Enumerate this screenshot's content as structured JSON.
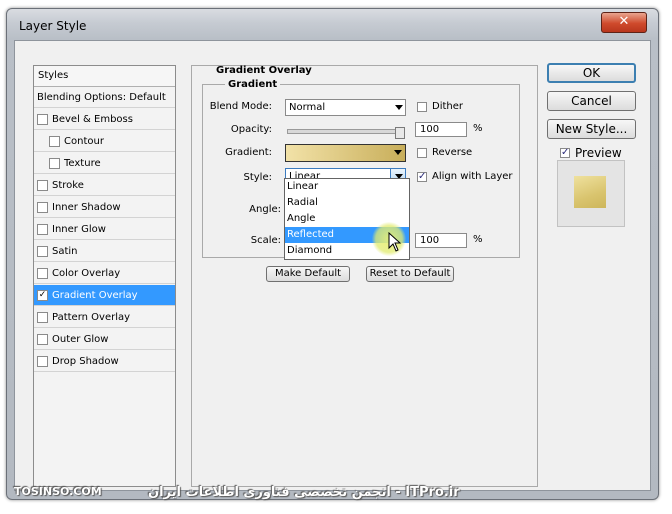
{
  "window": {
    "title": "Layer Style",
    "close_glyph": "✕"
  },
  "styles_panel": {
    "header": "Styles",
    "items": [
      {
        "label": "Blending Options: Default",
        "checkbox": false,
        "checked": false,
        "indent": false,
        "selected": false
      },
      {
        "label": "Bevel & Emboss",
        "checkbox": true,
        "checked": false,
        "indent": false,
        "selected": false
      },
      {
        "label": "Contour",
        "checkbox": true,
        "checked": false,
        "indent": true,
        "selected": false
      },
      {
        "label": "Texture",
        "checkbox": true,
        "checked": false,
        "indent": true,
        "selected": false
      },
      {
        "label": "Stroke",
        "checkbox": true,
        "checked": false,
        "indent": false,
        "selected": false
      },
      {
        "label": "Inner Shadow",
        "checkbox": true,
        "checked": false,
        "indent": false,
        "selected": false
      },
      {
        "label": "Inner Glow",
        "checkbox": true,
        "checked": false,
        "indent": false,
        "selected": false
      },
      {
        "label": "Satin",
        "checkbox": true,
        "checked": false,
        "indent": false,
        "selected": false
      },
      {
        "label": "Color Overlay",
        "checkbox": true,
        "checked": false,
        "indent": false,
        "selected": false
      },
      {
        "label": "Gradient Overlay",
        "checkbox": true,
        "checked": true,
        "indent": false,
        "selected": true
      },
      {
        "label": "Pattern Overlay",
        "checkbox": true,
        "checked": false,
        "indent": false,
        "selected": false
      },
      {
        "label": "Outer Glow",
        "checkbox": true,
        "checked": false,
        "indent": false,
        "selected": false
      },
      {
        "label": "Drop Shadow",
        "checkbox": true,
        "checked": false,
        "indent": false,
        "selected": false
      }
    ]
  },
  "gradient_overlay": {
    "group_title": "Gradient Overlay",
    "subgroup_title": "Gradient",
    "blend_mode_label": "Blend Mode:",
    "blend_mode_value": "Normal",
    "dither_label": "Dither",
    "opacity_label": "Opacity:",
    "opacity_value": "100",
    "opacity_unit": "%",
    "opacity_level": 1.0,
    "gradient_label": "Gradient:",
    "reverse_label": "Reverse",
    "style_label": "Style:",
    "style_value": "Linear",
    "align_label": "Align with Layer",
    "angle_label": "Angle:",
    "scale_label": "Scale:",
    "scale_value": "100",
    "scale_unit": "%",
    "make_default": "Make Default",
    "reset_default": "Reset to Default",
    "style_options": [
      "Linear",
      "Radial",
      "Angle",
      "Reflected",
      "Diamond"
    ],
    "highlighted_option": "Reflected"
  },
  "buttons": {
    "ok": "OK",
    "cancel": "Cancel",
    "new_style": "New Style...",
    "preview": "Preview"
  },
  "watermark": {
    "left": "TOSINSO.COM",
    "right": "انجمن تخصصی فناوری اطلاعات ایران - ITPro.ir"
  },
  "colors": {
    "selection": "#3399ff",
    "gradient_start": "#f2e2a8",
    "gradient_end": "#c8ae5a"
  }
}
